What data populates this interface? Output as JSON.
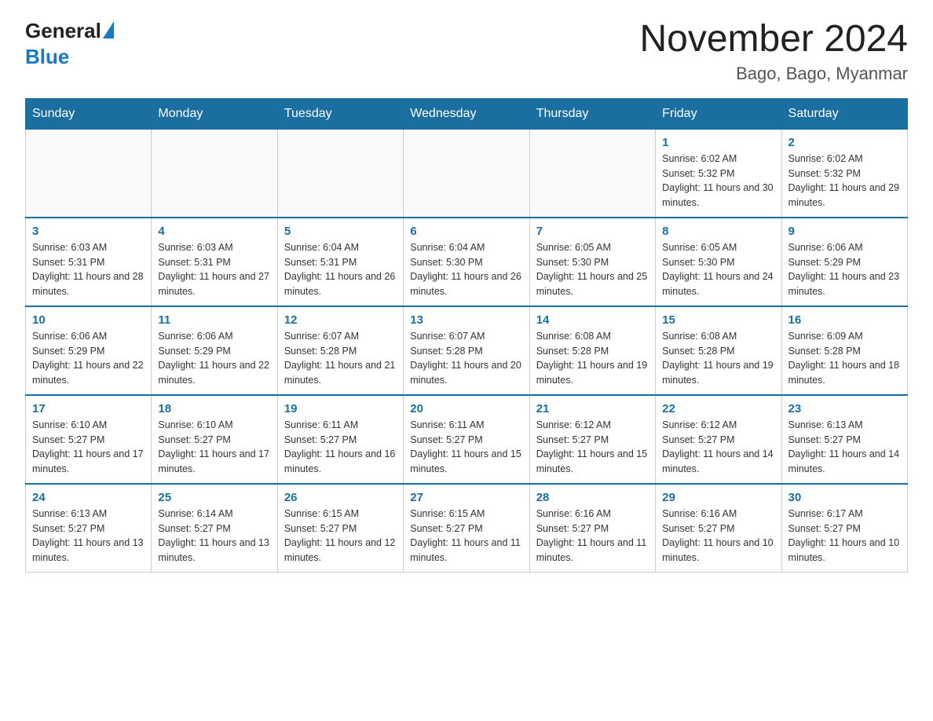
{
  "header": {
    "logo_general": "General",
    "logo_blue": "Blue",
    "month_title": "November 2024",
    "location": "Bago, Bago, Myanmar"
  },
  "days_of_week": [
    "Sunday",
    "Monday",
    "Tuesday",
    "Wednesday",
    "Thursday",
    "Friday",
    "Saturday"
  ],
  "weeks": [
    [
      {
        "day": "",
        "info": ""
      },
      {
        "day": "",
        "info": ""
      },
      {
        "day": "",
        "info": ""
      },
      {
        "day": "",
        "info": ""
      },
      {
        "day": "",
        "info": ""
      },
      {
        "day": "1",
        "info": "Sunrise: 6:02 AM\nSunset: 5:32 PM\nDaylight: 11 hours and 30 minutes."
      },
      {
        "day": "2",
        "info": "Sunrise: 6:02 AM\nSunset: 5:32 PM\nDaylight: 11 hours and 29 minutes."
      }
    ],
    [
      {
        "day": "3",
        "info": "Sunrise: 6:03 AM\nSunset: 5:31 PM\nDaylight: 11 hours and 28 minutes."
      },
      {
        "day": "4",
        "info": "Sunrise: 6:03 AM\nSunset: 5:31 PM\nDaylight: 11 hours and 27 minutes."
      },
      {
        "day": "5",
        "info": "Sunrise: 6:04 AM\nSunset: 5:31 PM\nDaylight: 11 hours and 26 minutes."
      },
      {
        "day": "6",
        "info": "Sunrise: 6:04 AM\nSunset: 5:30 PM\nDaylight: 11 hours and 26 minutes."
      },
      {
        "day": "7",
        "info": "Sunrise: 6:05 AM\nSunset: 5:30 PM\nDaylight: 11 hours and 25 minutes."
      },
      {
        "day": "8",
        "info": "Sunrise: 6:05 AM\nSunset: 5:30 PM\nDaylight: 11 hours and 24 minutes."
      },
      {
        "day": "9",
        "info": "Sunrise: 6:06 AM\nSunset: 5:29 PM\nDaylight: 11 hours and 23 minutes."
      }
    ],
    [
      {
        "day": "10",
        "info": "Sunrise: 6:06 AM\nSunset: 5:29 PM\nDaylight: 11 hours and 22 minutes."
      },
      {
        "day": "11",
        "info": "Sunrise: 6:06 AM\nSunset: 5:29 PM\nDaylight: 11 hours and 22 minutes."
      },
      {
        "day": "12",
        "info": "Sunrise: 6:07 AM\nSunset: 5:28 PM\nDaylight: 11 hours and 21 minutes."
      },
      {
        "day": "13",
        "info": "Sunrise: 6:07 AM\nSunset: 5:28 PM\nDaylight: 11 hours and 20 minutes."
      },
      {
        "day": "14",
        "info": "Sunrise: 6:08 AM\nSunset: 5:28 PM\nDaylight: 11 hours and 19 minutes."
      },
      {
        "day": "15",
        "info": "Sunrise: 6:08 AM\nSunset: 5:28 PM\nDaylight: 11 hours and 19 minutes."
      },
      {
        "day": "16",
        "info": "Sunrise: 6:09 AM\nSunset: 5:28 PM\nDaylight: 11 hours and 18 minutes."
      }
    ],
    [
      {
        "day": "17",
        "info": "Sunrise: 6:10 AM\nSunset: 5:27 PM\nDaylight: 11 hours and 17 minutes."
      },
      {
        "day": "18",
        "info": "Sunrise: 6:10 AM\nSunset: 5:27 PM\nDaylight: 11 hours and 17 minutes."
      },
      {
        "day": "19",
        "info": "Sunrise: 6:11 AM\nSunset: 5:27 PM\nDaylight: 11 hours and 16 minutes."
      },
      {
        "day": "20",
        "info": "Sunrise: 6:11 AM\nSunset: 5:27 PM\nDaylight: 11 hours and 15 minutes."
      },
      {
        "day": "21",
        "info": "Sunrise: 6:12 AM\nSunset: 5:27 PM\nDaylight: 11 hours and 15 minutes."
      },
      {
        "day": "22",
        "info": "Sunrise: 6:12 AM\nSunset: 5:27 PM\nDaylight: 11 hours and 14 minutes."
      },
      {
        "day": "23",
        "info": "Sunrise: 6:13 AM\nSunset: 5:27 PM\nDaylight: 11 hours and 14 minutes."
      }
    ],
    [
      {
        "day": "24",
        "info": "Sunrise: 6:13 AM\nSunset: 5:27 PM\nDaylight: 11 hours and 13 minutes."
      },
      {
        "day": "25",
        "info": "Sunrise: 6:14 AM\nSunset: 5:27 PM\nDaylight: 11 hours and 13 minutes."
      },
      {
        "day": "26",
        "info": "Sunrise: 6:15 AM\nSunset: 5:27 PM\nDaylight: 11 hours and 12 minutes."
      },
      {
        "day": "27",
        "info": "Sunrise: 6:15 AM\nSunset: 5:27 PM\nDaylight: 11 hours and 11 minutes."
      },
      {
        "day": "28",
        "info": "Sunrise: 6:16 AM\nSunset: 5:27 PM\nDaylight: 11 hours and 11 minutes."
      },
      {
        "day": "29",
        "info": "Sunrise: 6:16 AM\nSunset: 5:27 PM\nDaylight: 11 hours and 10 minutes."
      },
      {
        "day": "30",
        "info": "Sunrise: 6:17 AM\nSunset: 5:27 PM\nDaylight: 11 hours and 10 minutes."
      }
    ]
  ]
}
